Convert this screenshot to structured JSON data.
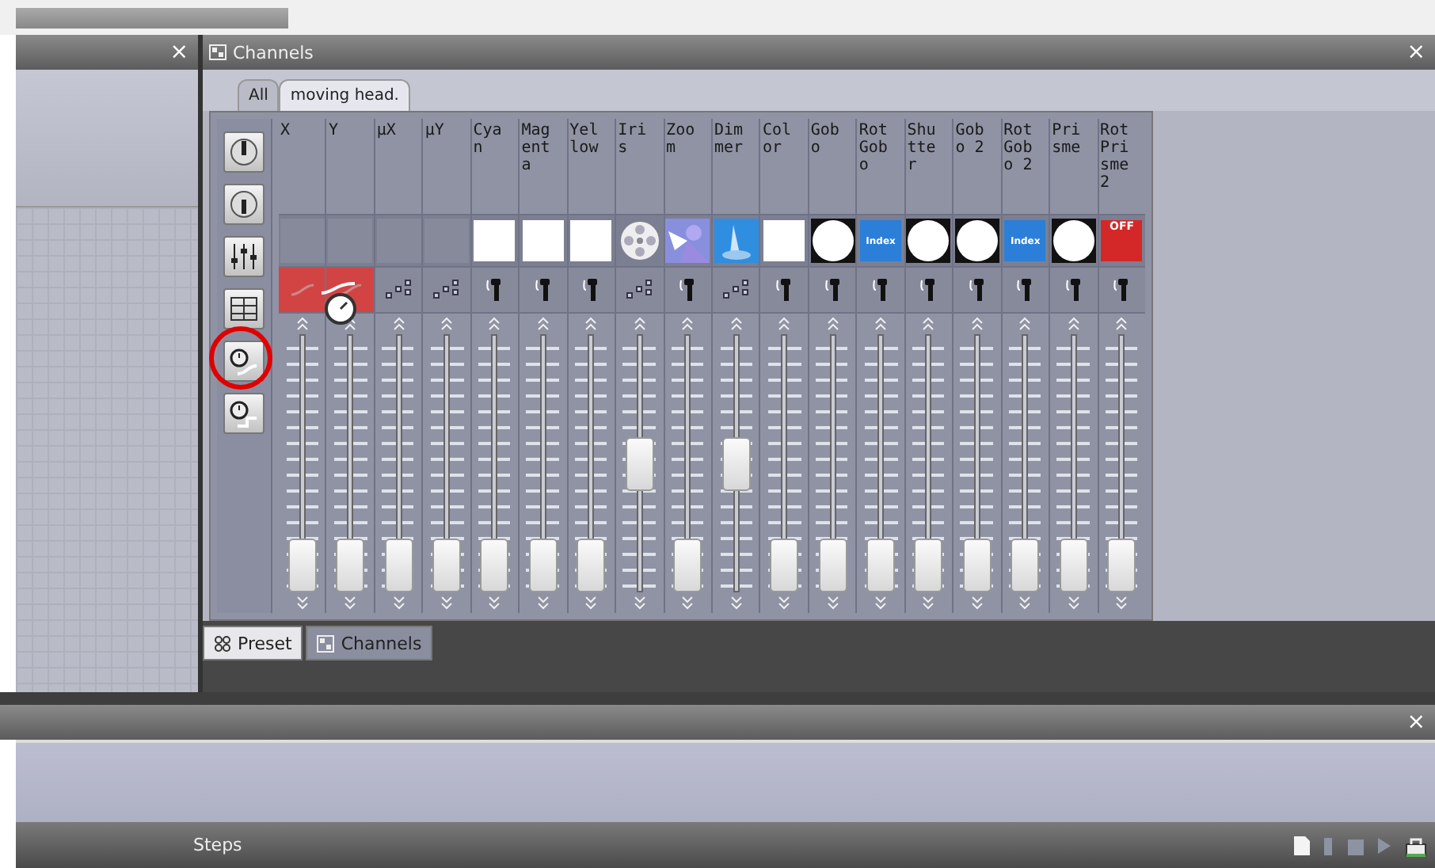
{
  "left_panel": {
    "close": "×"
  },
  "channels_panel": {
    "title": "Channels",
    "close": "×",
    "tabs": [
      {
        "label": "All",
        "selected": false
      },
      {
        "label": "moving head.",
        "selected": true
      }
    ],
    "tools": [
      {
        "kind": "knob",
        "circled": false
      },
      {
        "kind": "knob-down",
        "circled": false
      },
      {
        "kind": "mixer",
        "circled": false
      },
      {
        "kind": "ladder",
        "circled": false
      },
      {
        "kind": "timer-fade",
        "circled": true
      },
      {
        "kind": "timer-step",
        "circled": false
      }
    ],
    "channels": [
      {
        "name": "X",
        "swatch": {
          "kind": "empty"
        },
        "control": {
          "kind": "curve",
          "highlighted": true,
          "dragging": false
        },
        "level": 0
      },
      {
        "name": "Y",
        "swatch": {
          "kind": "empty"
        },
        "control": {
          "kind": "curve",
          "highlighted": true,
          "dragging": true
        },
        "level": 0
      },
      {
        "name": "μX",
        "swatch": {
          "kind": "empty"
        },
        "control": {
          "kind": "dots",
          "highlighted": false,
          "dragging": false
        },
        "level": 0
      },
      {
        "name": "μY",
        "swatch": {
          "kind": "empty"
        },
        "control": {
          "kind": "dots",
          "highlighted": false,
          "dragging": false
        },
        "level": 0
      },
      {
        "name": "Cyan",
        "swatch": {
          "kind": "white"
        },
        "control": {
          "kind": "knob",
          "highlighted": false,
          "dragging": false
        },
        "level": 0
      },
      {
        "name": "Magenta",
        "swatch": {
          "kind": "white"
        },
        "control": {
          "kind": "knob",
          "highlighted": false,
          "dragging": false
        },
        "level": 0
      },
      {
        "name": "Yellow",
        "swatch": {
          "kind": "white"
        },
        "control": {
          "kind": "knob",
          "highlighted": false,
          "dragging": false
        },
        "level": 0
      },
      {
        "name": "Iris",
        "swatch": {
          "kind": "wheel"
        },
        "control": {
          "kind": "dots",
          "highlighted": false,
          "dragging": false
        },
        "level": 0.5
      },
      {
        "name": "Zoom",
        "swatch": {
          "kind": "zoom"
        },
        "control": {
          "kind": "knob",
          "highlighted": false,
          "dragging": false
        },
        "level": 0
      },
      {
        "name": "Dimmer",
        "swatch": {
          "kind": "dimmer"
        },
        "control": {
          "kind": "dots",
          "highlighted": false,
          "dragging": false
        },
        "level": 0.5
      },
      {
        "name": "Color",
        "swatch": {
          "kind": "white"
        },
        "control": {
          "kind": "knob",
          "highlighted": false,
          "dragging": false
        },
        "level": 0
      },
      {
        "name": "Gobo",
        "swatch": {
          "kind": "circle"
        },
        "control": {
          "kind": "knob",
          "highlighted": false,
          "dragging": false
        },
        "level": 0
      },
      {
        "name": "Rot Gobo",
        "swatch": {
          "kind": "index",
          "label": "Index"
        },
        "control": {
          "kind": "knob",
          "highlighted": false,
          "dragging": false
        },
        "level": 0
      },
      {
        "name": "Shutter",
        "swatch": {
          "kind": "circle"
        },
        "control": {
          "kind": "knob",
          "highlighted": false,
          "dragging": false
        },
        "level": 0
      },
      {
        "name": "Gobo 2",
        "swatch": {
          "kind": "circle"
        },
        "control": {
          "kind": "knob",
          "highlighted": false,
          "dragging": false
        },
        "level": 0
      },
      {
        "name": "Rot Gobo 2",
        "swatch": {
          "kind": "index",
          "label": "Index"
        },
        "control": {
          "kind": "knob",
          "highlighted": false,
          "dragging": false
        },
        "level": 0
      },
      {
        "name": "Prisme",
        "swatch": {
          "kind": "circle"
        },
        "control": {
          "kind": "knob",
          "highlighted": false,
          "dragging": false
        },
        "level": 0
      },
      {
        "name": "Rot Prisme 2",
        "swatch": {
          "kind": "off",
          "label": "OFF"
        },
        "control": {
          "kind": "knob",
          "highlighted": false,
          "dragging": false
        },
        "level": 0
      }
    ],
    "bottom_tabs": [
      {
        "label": "Preset",
        "selected": true
      },
      {
        "label": "Channels",
        "selected": false
      }
    ]
  },
  "lower_panel": {
    "close": "×"
  },
  "status_bar": {
    "label": "Steps"
  }
}
